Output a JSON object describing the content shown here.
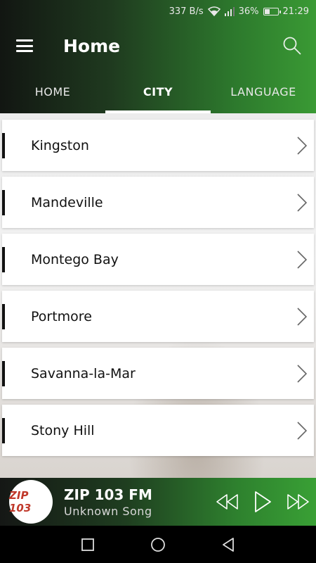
{
  "status": {
    "speed": "337 B/s",
    "battery": "36%",
    "time": "21:29"
  },
  "appbar": {
    "title": "Home"
  },
  "tabs": [
    {
      "label": "HOME",
      "active": false
    },
    {
      "label": "CITY",
      "active": true
    },
    {
      "label": "LANGUAGE",
      "active": false
    }
  ],
  "cities": [
    {
      "label": "Kingston"
    },
    {
      "label": "Mandeville"
    },
    {
      "label": "Montego Bay"
    },
    {
      "label": "Portmore"
    },
    {
      "label": "Savanna-la-Mar"
    },
    {
      "label": "Stony Hill"
    }
  ],
  "player": {
    "logo_text": "ZIP 103",
    "station_name": "ZIP 103 FM",
    "song": "Unknown Song"
  },
  "colors": {
    "accent": "#3a9a34",
    "dark": "#121612"
  }
}
